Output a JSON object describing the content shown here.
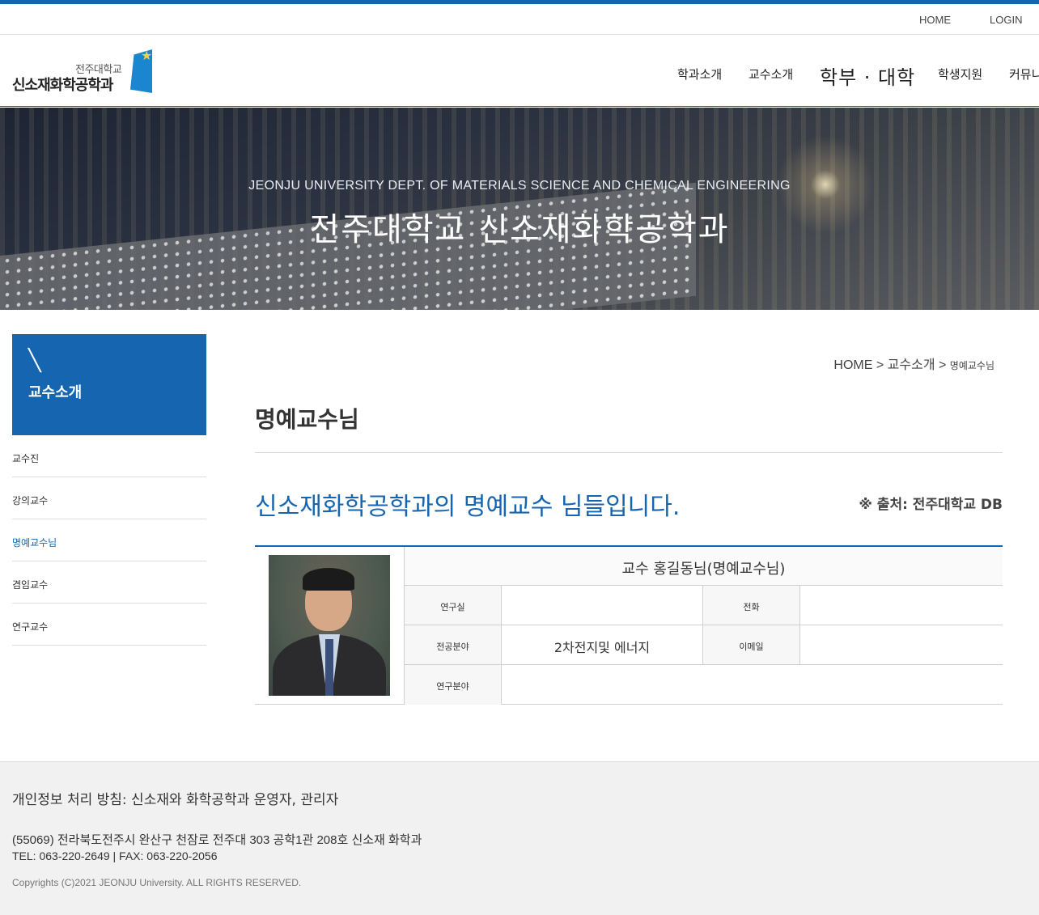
{
  "util_nav": {
    "home": "HOME",
    "login": "LOGIN"
  },
  "logo": {
    "small_text": "전주대학교",
    "main_text": "신소재화학공학과"
  },
  "gnb": [
    "학과소개",
    "교수소개",
    "학부 · 대학",
    "학생지원",
    "커뮤니티"
  ],
  "banner": {
    "subtitle": "JEONJU UNIVERSITY DEPT. OF MATERIALS SCIENCE AND CHEMICAL ENGINEERING",
    "title": "전주대학교 신소재화학공학과"
  },
  "lnb": {
    "icon": "pencil-icon",
    "title": "교수소개",
    "items": [
      "교수진",
      "강의교수",
      "명예교수님",
      "겸임교수",
      "연구교수"
    ],
    "active_index": 2
  },
  "breadcrumb": {
    "home": "HOME",
    "sep": ">",
    "mid": "교수소개",
    "last": "명예교수님"
  },
  "page_title": "명예교수님",
  "lead_text": "신소재화학공학과의 명예교수 님들입니다.",
  "source_text": "※ 출처: 전주대학교 DB",
  "profile": {
    "name": "교수 홍길동님(명예교수님)",
    "labels": {
      "office": "연구실",
      "phone": "전화",
      "major": "전공분야",
      "email": "이메일",
      "research": "연구분야"
    },
    "values": {
      "office": "",
      "phone": "",
      "major": "2차전지및 에너지",
      "email": "",
      "research": ""
    }
  },
  "footer": {
    "line1": "개인정보 처리 방침: 신소재와 화학공학과 운영자, 관리자",
    "line2": "(55069) 전라북도전주시 완산구 천잠로 전주대 303 공학1관 208호 신소재 화학과",
    "line3": "TEL: 063-220-2649 | FAX: 063-220-2056",
    "copyright": "Copyrights (C)2021 JEONJU University. ALL RIGHTS RESERVED."
  },
  "colors": {
    "accent": "#1565b0",
    "footer_bg": "#f1f1f1"
  }
}
